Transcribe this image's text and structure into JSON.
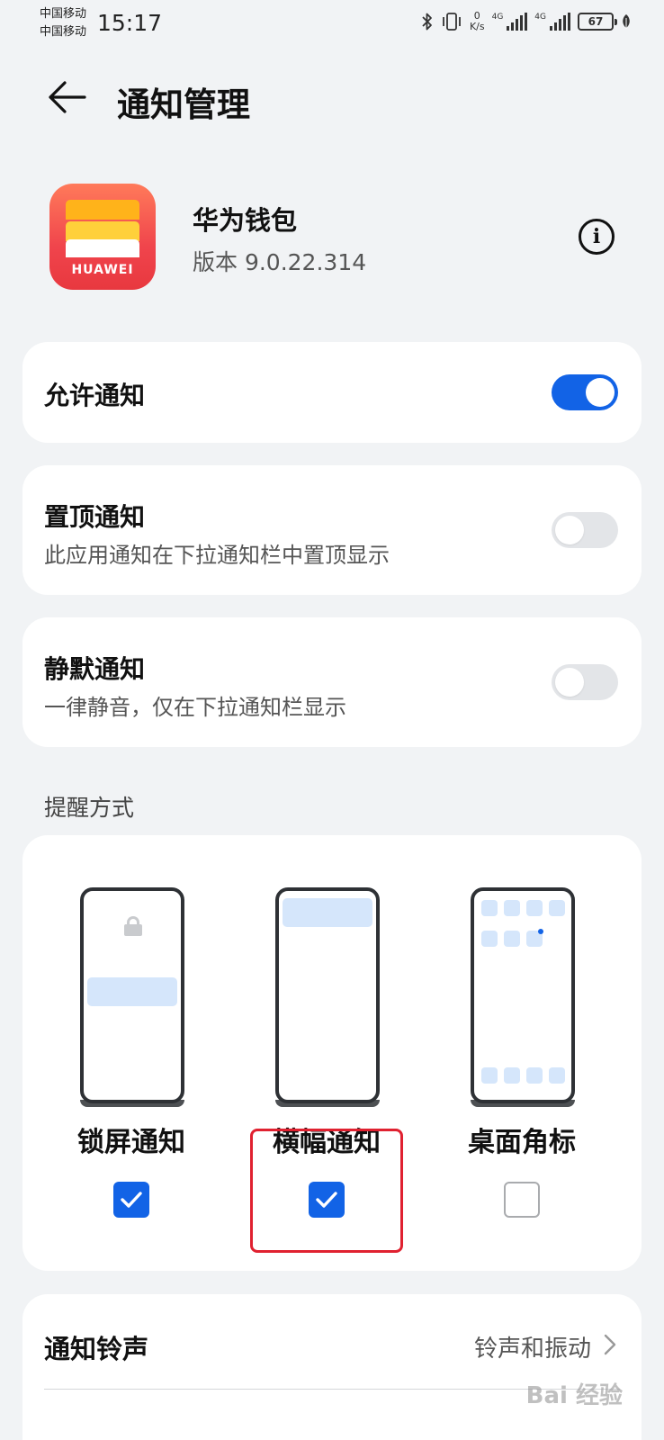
{
  "status_bar": {
    "carrier_1": "中国移动",
    "carrier_2": "中国移动",
    "time": "15:17",
    "net_speed_value": "0",
    "net_speed_unit": "K/s",
    "sim1_tag": "4G",
    "sim2_tag": "4G",
    "battery": "67"
  },
  "header": {
    "title": "通知管理"
  },
  "app": {
    "icon_brand": "HUAWEI",
    "name": "华为钱包",
    "version": "版本 9.0.22.314"
  },
  "settings": {
    "allow": {
      "title": "允许通知",
      "enabled": true
    },
    "pinned": {
      "title": "置顶通知",
      "subtitle": "此应用通知在下拉通知栏中置顶显示",
      "enabled": false
    },
    "silent": {
      "title": "静默通知",
      "subtitle": "一律静音，仅在下拉通知栏显示",
      "enabled": false
    }
  },
  "reminder": {
    "section_label": "提醒方式",
    "options": [
      {
        "label": "锁屏通知",
        "checked": true
      },
      {
        "label": "横幅通知",
        "checked": true
      },
      {
        "label": "桌面角标",
        "checked": false
      }
    ]
  },
  "ringtone": {
    "label": "通知铃声",
    "value": "铃声和振动"
  },
  "watermark": "Bai 经验",
  "colors": {
    "accent": "#1263e6",
    "highlight_border": "#e02130",
    "page_background": "#f1f3f5"
  }
}
